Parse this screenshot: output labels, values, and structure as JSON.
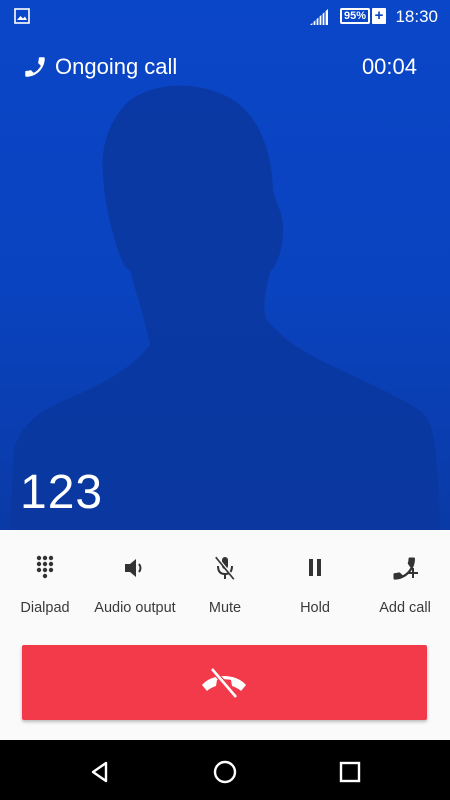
{
  "status_bar": {
    "battery_percent": "95%",
    "battery_charging_symbol": "+",
    "time": "18:30",
    "icons": [
      "gallery-icon",
      "signal-icon",
      "battery-icon"
    ]
  },
  "call": {
    "state": "Ongoing call",
    "duration": "00:04",
    "number": "123"
  },
  "controls": [
    {
      "name": "dialpad",
      "label": "Dialpad",
      "icon": "dialpad-icon"
    },
    {
      "name": "audio-output",
      "label": "Audio output",
      "icon": "speaker-icon"
    },
    {
      "name": "mute",
      "label": "Mute",
      "icon": "mic-off-icon"
    },
    {
      "name": "hold",
      "label": "Hold",
      "icon": "pause-icon"
    },
    {
      "name": "add-call",
      "label": "Add call",
      "icon": "add-call-icon"
    }
  ],
  "end_call": {
    "icon": "end-call-icon"
  },
  "nav": [
    "back-icon",
    "home-icon",
    "recents-icon"
  ],
  "colors": {
    "call_background": "#0a46c8",
    "silhouette": "#0a379f",
    "end_call": "#f23a4a",
    "controls_background": "#fafafa"
  }
}
